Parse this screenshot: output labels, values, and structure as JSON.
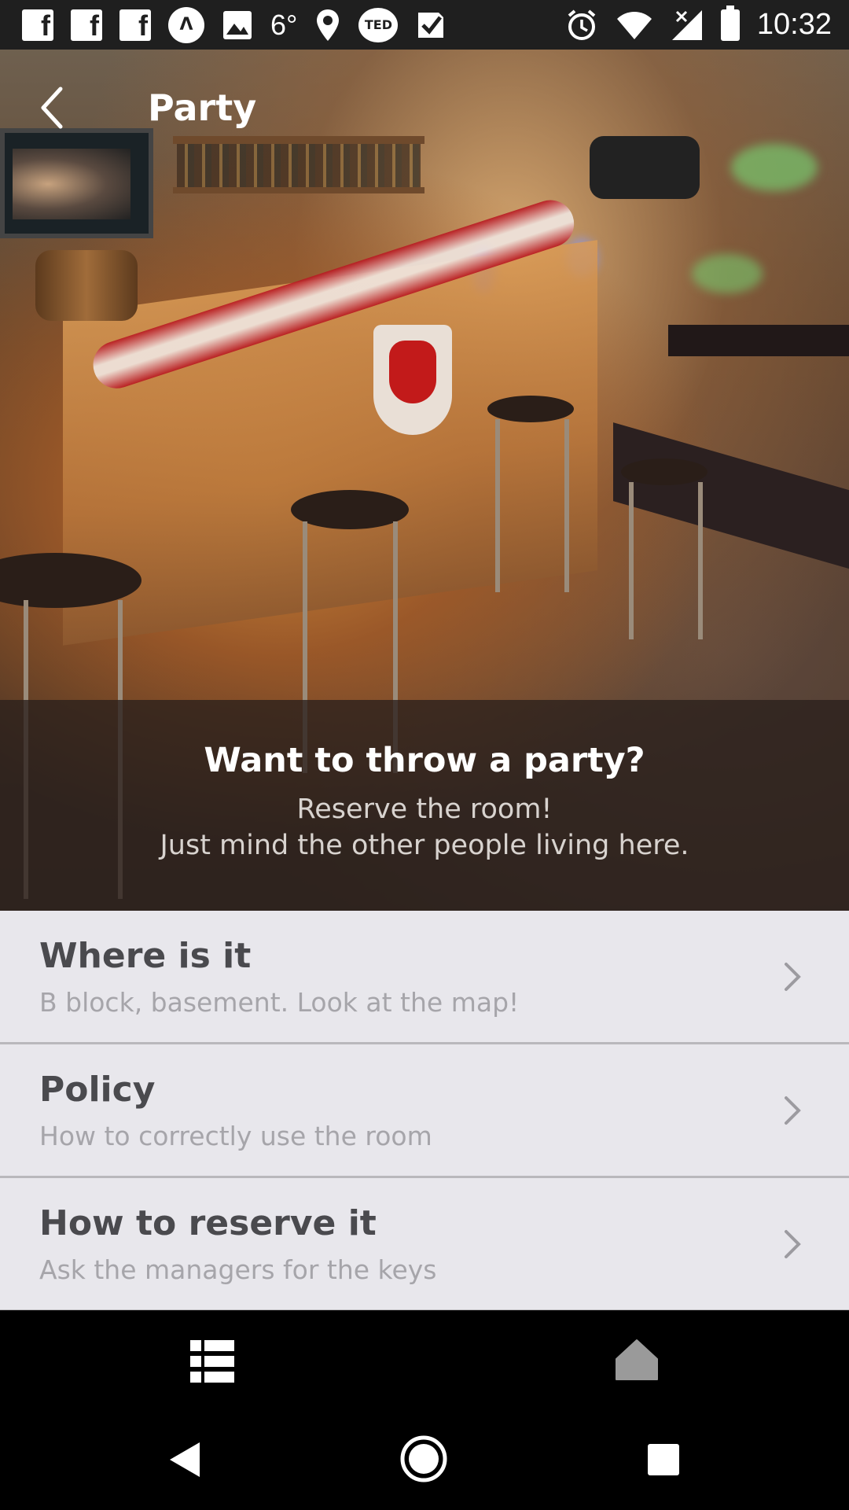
{
  "status_bar": {
    "temperature": "6°",
    "ted_label": "TED",
    "time": "10:32"
  },
  "app_bar": {
    "title": "Party"
  },
  "hero": {
    "headline": "Want to throw a party?",
    "subline_1": "Reserve the room!",
    "subline_2": "Just mind the other people living here."
  },
  "list": {
    "items": [
      {
        "title": "Where is it",
        "subtitle": "B block, basement. Look at the map!"
      },
      {
        "title": "Policy",
        "subtitle": "How to correctly use the room"
      },
      {
        "title": "How to reserve it",
        "subtitle": "Ask the managers for the keys"
      }
    ]
  },
  "colors": {
    "status_bar_bg": "#1f1f1f",
    "list_bg": "#e8e7ec",
    "title_text": "#4a4a4e",
    "subtitle_text": "#a6a5aa",
    "nav_icon": "#ffffff",
    "home_icon": "#9a9a9a"
  },
  "icons": {
    "bottom_nav_left": "list-menu-icon",
    "bottom_nav_right": "home-icon"
  }
}
